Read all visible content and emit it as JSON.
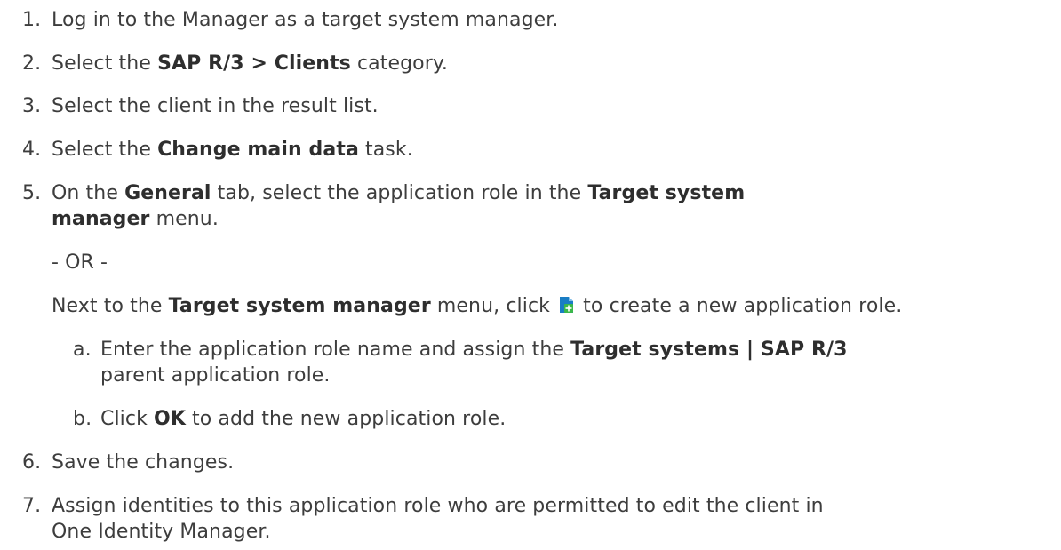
{
  "steps": [
    {
      "num": "1.",
      "text": "Log in to the Manager as a target system manager."
    },
    {
      "num": "2.",
      "pre": "Select the ",
      "bold": "SAP R/3 > Clients",
      "post": " category."
    },
    {
      "num": "3.",
      "text": "Select the client in the result list."
    },
    {
      "num": "4.",
      "pre": "Select the ",
      "bold": "Change main data",
      "post": " task."
    },
    {
      "num": "5.",
      "line1_pre": "On the ",
      "line1_bold1": "General",
      "line1_mid": " tab, select the application role in the ",
      "line1_bold2": "Target system",
      "line2_bold": "manager",
      "line2_post": "  menu.",
      "or": "- OR -",
      "next_pre": "Next to the ",
      "next_bold": "Target system manager",
      "next_mid": " menu, click ",
      "next_post": " to create a new application role.",
      "icon": "add-application-role-icon",
      "substeps": [
        {
          "num": "a.",
          "pre": "Enter the application role name and assign the ",
          "bold": "Target systems | SAP R/3",
          "line2": "parent application role."
        },
        {
          "num": "b.",
          "pre": "Click ",
          "bold": "OK",
          "post": " to add the new application role."
        }
      ]
    },
    {
      "num": "6.",
      "text": "Save the changes."
    },
    {
      "num": "7.",
      "line1": "Assign identities to this application role who are permitted to edit the client in",
      "line2": "One Identity Manager."
    }
  ],
  "colors": {
    "text": "#3d3d3d",
    "icon_page": "#1a7dc4",
    "icon_plus": "#3bb84a"
  }
}
